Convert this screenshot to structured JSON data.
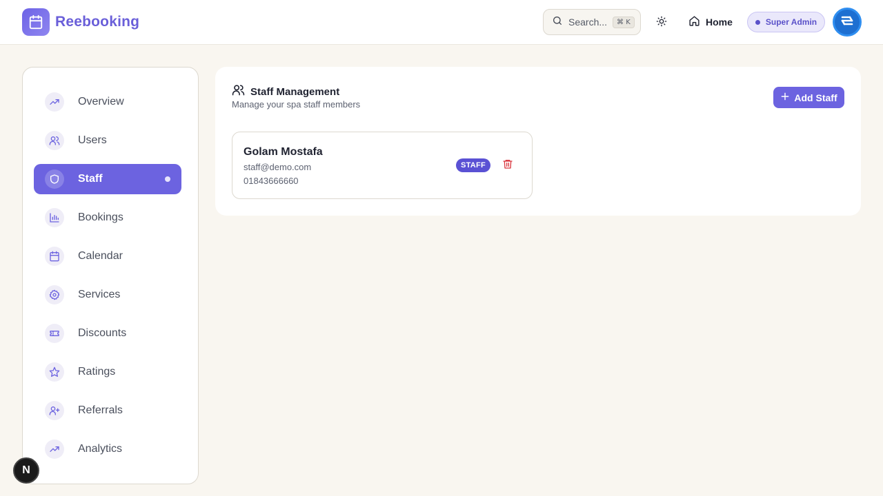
{
  "header": {
    "brand": "Reebooking",
    "search_placeholder": "Search...",
    "search_shortcut": "⌘ K",
    "home_label": "Home",
    "role_badge": "Super Admin"
  },
  "sidebar": {
    "items": [
      {
        "label": "Overview",
        "icon": "trending-up-icon"
      },
      {
        "label": "Users",
        "icon": "users-icon"
      },
      {
        "label": "Staff",
        "icon": "shield-icon",
        "active": true
      },
      {
        "label": "Bookings",
        "icon": "bar-chart-icon"
      },
      {
        "label": "Calendar",
        "icon": "calendar-icon"
      },
      {
        "label": "Services",
        "icon": "gear-icon"
      },
      {
        "label": "Discounts",
        "icon": "ticket-icon"
      },
      {
        "label": "Ratings",
        "icon": "star-icon"
      },
      {
        "label": "Referrals",
        "icon": "user-plus-icon"
      },
      {
        "label": "Analytics",
        "icon": "trending-up-icon"
      }
    ]
  },
  "main": {
    "title": "Staff Management",
    "subtitle": "Manage your spa staff members",
    "add_button": "Add Staff",
    "staff": [
      {
        "name": "Golam Mostafa",
        "email": "staff@demo.com",
        "phone": "01843666660",
        "role": "STAFF"
      }
    ]
  },
  "dev_badge": "N",
  "colors": {
    "accent": "#6c63e0",
    "background": "#f9f6f0",
    "delete": "#d9363e"
  }
}
